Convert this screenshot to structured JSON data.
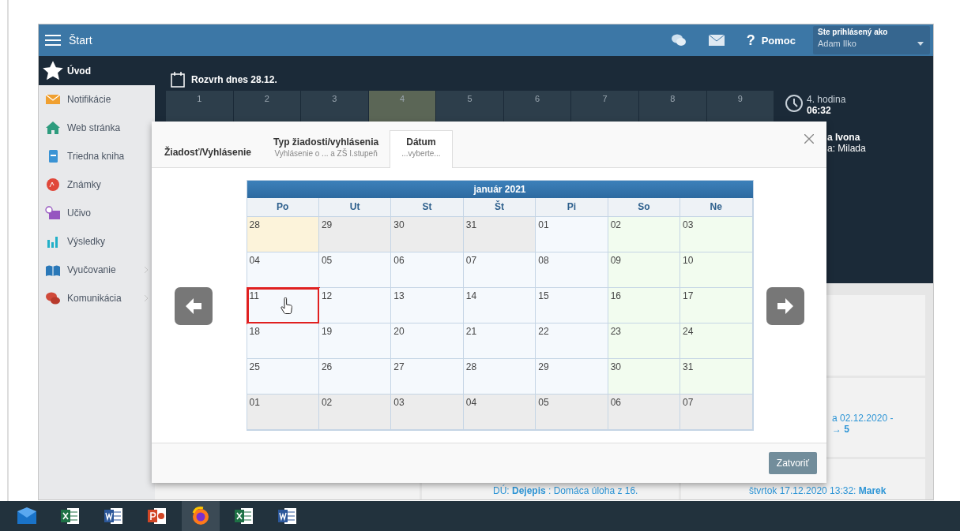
{
  "topbar": {
    "title": "Štart",
    "help_glyph": "?",
    "help_label": "Pomoc",
    "user_caption": "Ste prihlásený ako",
    "user_name": "Adam Ilko"
  },
  "sidebar": {
    "items": [
      {
        "label": "Úvod",
        "kind": "star",
        "selected": true,
        "has_submenu": false
      },
      {
        "label": "Notifikácie",
        "kind": "envelope",
        "selected": false,
        "has_submenu": false
      },
      {
        "label": "Web stránka",
        "kind": "house",
        "selected": false,
        "has_submenu": false
      },
      {
        "label": "Triedna kniha",
        "kind": "notebook",
        "selected": false,
        "has_submenu": false
      },
      {
        "label": "Známky",
        "kind": "grade",
        "selected": false,
        "has_submenu": false
      },
      {
        "label": "Učivo",
        "kind": "board",
        "selected": false,
        "has_submenu": false
      },
      {
        "label": "Výsledky",
        "kind": "bars",
        "selected": false,
        "has_submenu": false
      },
      {
        "label": "Vyučovanie",
        "kind": "book",
        "selected": false,
        "has_submenu": true
      },
      {
        "label": "Komunikácia",
        "kind": "chat",
        "selected": false,
        "has_submenu": true
      }
    ]
  },
  "schedule": {
    "title": "Rozvrh dnes 28.12.",
    "periods": [
      {
        "label": "1",
        "selected": false
      },
      {
        "label": "2",
        "selected": false
      },
      {
        "label": "3",
        "selected": false
      },
      {
        "label": "4",
        "selected": true
      },
      {
        "label": "5",
        "selected": false
      },
      {
        "label": "6",
        "selected": false
      },
      {
        "label": "7",
        "selected": false
      },
      {
        "label": "8",
        "selected": false
      },
      {
        "label": "9",
        "selected": false
      }
    ],
    "current_period": "4. hodina",
    "time": "06:32",
    "teacher": "a Ivona",
    "substitute": "a: Milada"
  },
  "feed": {
    "card_lines": [
      "a 02.12.2020 -",
      "**→ 5**"
    ],
    "homework": "DÚ: **Dejepis** : Domáca úloha z 16.",
    "message": "štvrtok 17.12.2020 13:32: **Marek**"
  },
  "dialog": {
    "steps": [
      {
        "title": "Žiadosť/Vyhlásenie",
        "selected": false
      },
      {
        "title": "Typ žiadosti/vyhlásenia",
        "subtitle": "Vyhlásenie o ... a ZŠ I.stupeň",
        "selected": false
      },
      {
        "title": "Dátum",
        "subtitle": "...vyberte...",
        "selected": true
      }
    ],
    "calendar": {
      "month": "január 2021",
      "weekdays": [
        "Po",
        "Ut",
        "St",
        "Št",
        "Pi",
        "So",
        "Ne"
      ],
      "weeks": [
        [
          {
            "day": "28",
            "kind": "today",
            "selected": false
          },
          {
            "day": "29",
            "kind": "other",
            "selected": false
          },
          {
            "day": "30",
            "kind": "other",
            "selected": false
          },
          {
            "day": "31",
            "kind": "other",
            "selected": false
          },
          {
            "day": "01",
            "kind": "weekday",
            "selected": false
          },
          {
            "day": "02",
            "kind": "weekend",
            "selected": false
          },
          {
            "day": "03",
            "kind": "weekend",
            "selected": false
          }
        ],
        [
          {
            "day": "04",
            "kind": "weekday",
            "selected": false
          },
          {
            "day": "05",
            "kind": "weekday",
            "selected": false
          },
          {
            "day": "06",
            "kind": "weekday",
            "selected": false
          },
          {
            "day": "07",
            "kind": "weekday",
            "selected": false
          },
          {
            "day": "08",
            "kind": "weekday",
            "selected": false
          },
          {
            "day": "09",
            "kind": "weekend",
            "selected": false
          },
          {
            "day": "10",
            "kind": "weekend",
            "selected": false
          }
        ],
        [
          {
            "day": "11",
            "kind": "weekday",
            "selected": true
          },
          {
            "day": "12",
            "kind": "weekday",
            "selected": false
          },
          {
            "day": "13",
            "kind": "weekday",
            "selected": false
          },
          {
            "day": "14",
            "kind": "weekday",
            "selected": false
          },
          {
            "day": "15",
            "kind": "weekday",
            "selected": false
          },
          {
            "day": "16",
            "kind": "weekend",
            "selected": false
          },
          {
            "day": "17",
            "kind": "weekend",
            "selected": false
          }
        ],
        [
          {
            "day": "18",
            "kind": "weekday",
            "selected": false
          },
          {
            "day": "19",
            "kind": "weekday",
            "selected": false
          },
          {
            "day": "20",
            "kind": "weekday",
            "selected": false
          },
          {
            "day": "21",
            "kind": "weekday",
            "selected": false
          },
          {
            "day": "22",
            "kind": "weekday",
            "selected": false
          },
          {
            "day": "23",
            "kind": "weekend",
            "selected": false
          },
          {
            "day": "24",
            "kind": "weekend",
            "selected": false
          }
        ],
        [
          {
            "day": "25",
            "kind": "weekday",
            "selected": false
          },
          {
            "day": "26",
            "kind": "weekday",
            "selected": false
          },
          {
            "day": "27",
            "kind": "weekday",
            "selected": false
          },
          {
            "day": "28",
            "kind": "weekday",
            "selected": false
          },
          {
            "day": "29",
            "kind": "weekday",
            "selected": false
          },
          {
            "day": "30",
            "kind": "weekend",
            "selected": false
          },
          {
            "day": "31",
            "kind": "weekend",
            "selected": false
          }
        ],
        [
          {
            "day": "01",
            "kind": "other",
            "selected": false
          },
          {
            "day": "02",
            "kind": "other",
            "selected": false
          },
          {
            "day": "03",
            "kind": "other",
            "selected": false
          },
          {
            "day": "04",
            "kind": "other",
            "selected": false
          },
          {
            "day": "05",
            "kind": "other",
            "selected": false
          },
          {
            "day": "06",
            "kind": "other",
            "selected": false
          },
          {
            "day": "07",
            "kind": "other",
            "selected": false
          }
        ]
      ]
    },
    "close_button": "Zatvoriť"
  },
  "taskbar": [
    {
      "kind": "mail",
      "selected": false
    },
    {
      "kind": "sheet",
      "selected": false
    },
    {
      "kind": "doc",
      "selected": false
    },
    {
      "kind": "slides",
      "selected": false
    },
    {
      "kind": "browser",
      "selected": true
    },
    {
      "kind": "sheet",
      "selected": false
    },
    {
      "kind": "doc",
      "selected": false
    }
  ]
}
